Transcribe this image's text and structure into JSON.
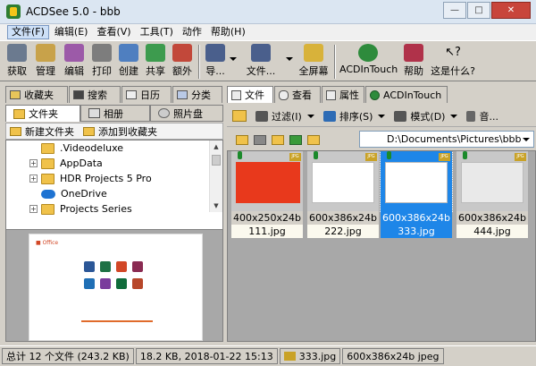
{
  "window": {
    "title": "ACDSee 5.0 - bbb"
  },
  "menu": [
    "文件(F)",
    "编辑(E)",
    "查看(V)",
    "工具(T)",
    "动作",
    "帮助(H)"
  ],
  "toolbar": {
    "acquire": "获取",
    "manage": "管理",
    "edit": "编辑",
    "print": "打印",
    "create": "创建",
    "share": "共享",
    "extra": "额外",
    "import": "导...",
    "file": "文件...",
    "fullscreen": "全屏幕",
    "acdintouch": "ACDInTouch",
    "help": "帮助",
    "whatsthis": "这是什么?"
  },
  "left": {
    "tabs": [
      "收藏夹",
      "搜索",
      "日历",
      "分类"
    ],
    "subtabs": [
      "文件夹",
      "相册",
      "照片盘"
    ],
    "folder_actions": [
      "新建文件夹",
      "添加到收藏夹"
    ],
    "tree": [
      ".Videodeluxe",
      "AppData",
      "HDR Projects 5 Pro",
      "OneDrive",
      "Projects Series"
    ]
  },
  "right": {
    "tabs": [
      "文件",
      "查看",
      "属性",
      "ACDInTouch"
    ],
    "tools": {
      "filter": "过滤(I)",
      "sort": "排序(S)",
      "mode": "模式(D)",
      "audio": "音..."
    },
    "path": "D:\\Documents\\Pictures\\bbb",
    "thumbnails": [
      {
        "dims": "400x250x24b",
        "name": "111.jpg"
      },
      {
        "dims": "600x386x24b",
        "name": "222.jpg"
      },
      {
        "dims": "600x386x24b",
        "name": "333.jpg"
      },
      {
        "dims": "600x386x24b",
        "name": "444.jpg"
      }
    ]
  },
  "status": {
    "total": "总计 12 个文件 (243.2 KB)",
    "fileinfo": "18.2 KB, 2018-01-22 15:13",
    "filename": "333.jpg",
    "imageinfo": "600x386x24b jpeg"
  },
  "colors": {
    "selection": "#1e86e8",
    "office_red": "#e8391c"
  }
}
